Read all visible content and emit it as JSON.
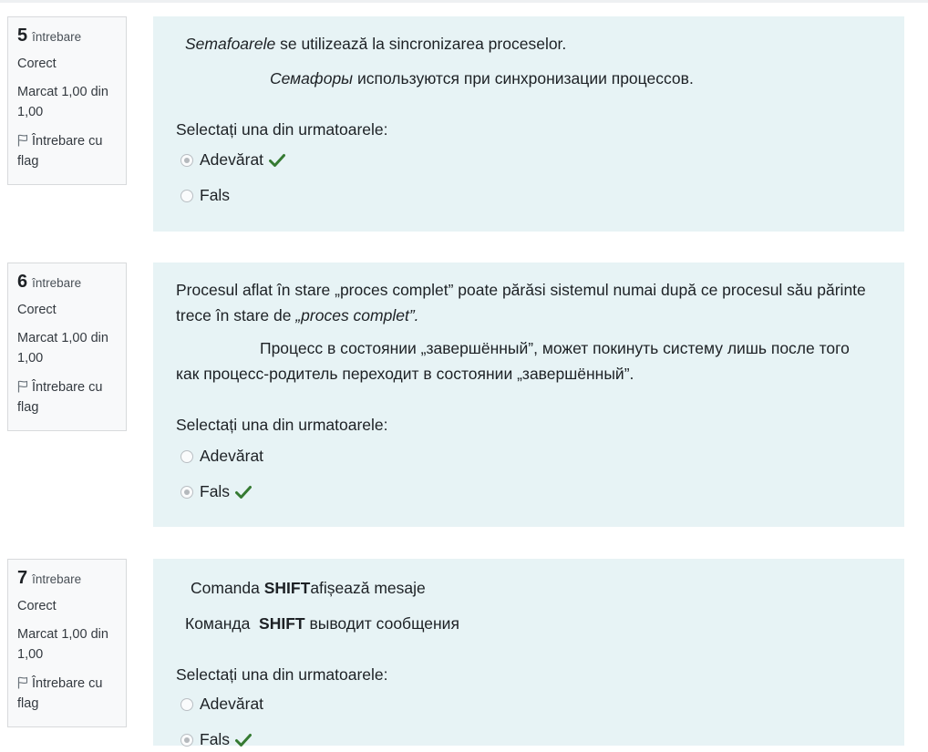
{
  "questions": [
    {
      "number": "5",
      "word": "întrebare",
      "state": "Corect",
      "grade": "Marcat 1,00 din 1,00",
      "flag": "Întrebare cu flag",
      "text_ro_italic": "Semafoarele",
      "text_ro_rest": " se utilizează la sincronizarea proceselor.",
      "text_ru_italic": "Семафоры",
      "text_ru_rest": " используются при синхронизации процессов.",
      "prompt": "Selectați una din urmatoarele:",
      "answers": [
        {
          "label": "Adevărat",
          "selected": true,
          "correct": true
        },
        {
          "label": "Fals",
          "selected": false,
          "correct": false
        }
      ]
    },
    {
      "number": "6",
      "word": "întrebare",
      "state": "Corect",
      "grade": "Marcat 1,00 din 1,00",
      "flag": "Întrebare cu flag",
      "text_ro": "Procesul aflat în stare „proces complet” poate părăsi sistemul numai după ce procesul său părinte trece în stare de",
      "text_ro_italic": "„proces complet”.",
      "text_ru": "Процесс в состоянии  „завершённый”, может покинуть систему лишь после того как процесс-родитель переходит в состоянии „завершённый”.",
      "prompt": "Selectați una din urmatoarele:",
      "answers": [
        {
          "label": "Adevărat",
          "selected": false,
          "correct": false
        },
        {
          "label": "Fals",
          "selected": true,
          "correct": true
        }
      ]
    },
    {
      "number": "7",
      "word": "întrebare",
      "state": "Corect",
      "grade": "Marcat 1,00 din 1,00",
      "flag": "Întrebare cu flag",
      "text_ro_pre": "Comanda ",
      "text_ro_bold": "SHIFT",
      "text_ro_post": "afișează mesaje",
      "text_ru_pre": "Команда  ",
      "text_ru_bold": "SHIFT",
      "text_ru_post": " выводит сообщения",
      "prompt": "Selectați una din urmatoarele:",
      "answers": [
        {
          "label": "Adevărat",
          "selected": false,
          "correct": false
        },
        {
          "label": "Fals",
          "selected": true,
          "correct": true
        }
      ]
    }
  ],
  "colors": {
    "correct_check": "#357a32",
    "content_background": "#e7f3f5",
    "info_background": "#f8f9fa"
  },
  "icons": {
    "flag": "flag-icon",
    "correct": "check-icon"
  }
}
